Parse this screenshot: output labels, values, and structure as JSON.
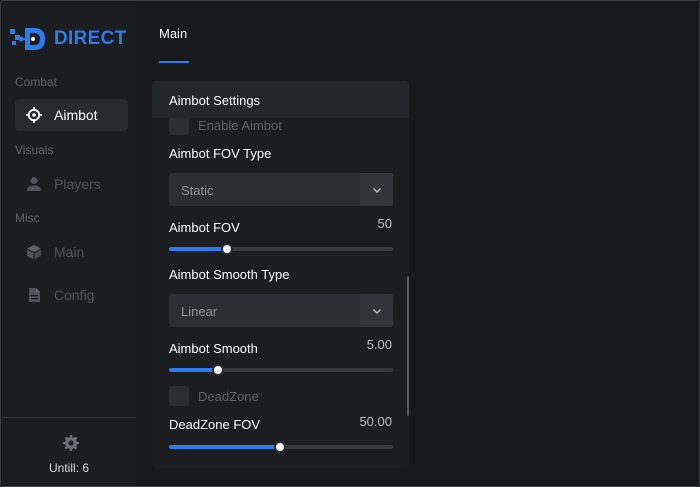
{
  "app": {
    "brand": "DIRECT",
    "accent_color": "#2a7cf0",
    "footer_text": "Untill: 6"
  },
  "sidebar": {
    "sections": [
      {
        "label": "Combat",
        "items": [
          {
            "label": "Aimbot",
            "icon": "crosshair-icon",
            "active": true
          }
        ]
      },
      {
        "label": "Visuals",
        "items": [
          {
            "label": "Players",
            "icon": "user-icon",
            "active": false
          }
        ]
      },
      {
        "label": "Misc",
        "items": [
          {
            "label": "Main",
            "icon": "cube-icon",
            "active": false
          },
          {
            "label": "Config",
            "icon": "document-icon",
            "active": false
          }
        ]
      }
    ],
    "footer_icon": "gear-icon"
  },
  "header": {
    "tabs": [
      {
        "label": "Main",
        "active": true
      }
    ]
  },
  "panel": {
    "title": "Aimbot Settings",
    "enable_aimbot": {
      "label": "Enable Aimbot",
      "checked": false
    },
    "fov_type": {
      "label": "Aimbot FOV Type",
      "value": "Static"
    },
    "fov": {
      "label": "Aimbot FOV",
      "value_text": "50",
      "fraction": 0.26
    },
    "smooth_type": {
      "label": "Aimbot Smooth Type",
      "value": "Linear"
    },
    "smooth": {
      "label": "Aimbot Smooth",
      "value_text": "5.00",
      "fraction": 0.22
    },
    "deadzone": {
      "label": "DeadZone",
      "checked": false
    },
    "deadzone_fov": {
      "label": "DeadZone FOV",
      "value_text": "50.00",
      "fraction": 0.495
    }
  }
}
